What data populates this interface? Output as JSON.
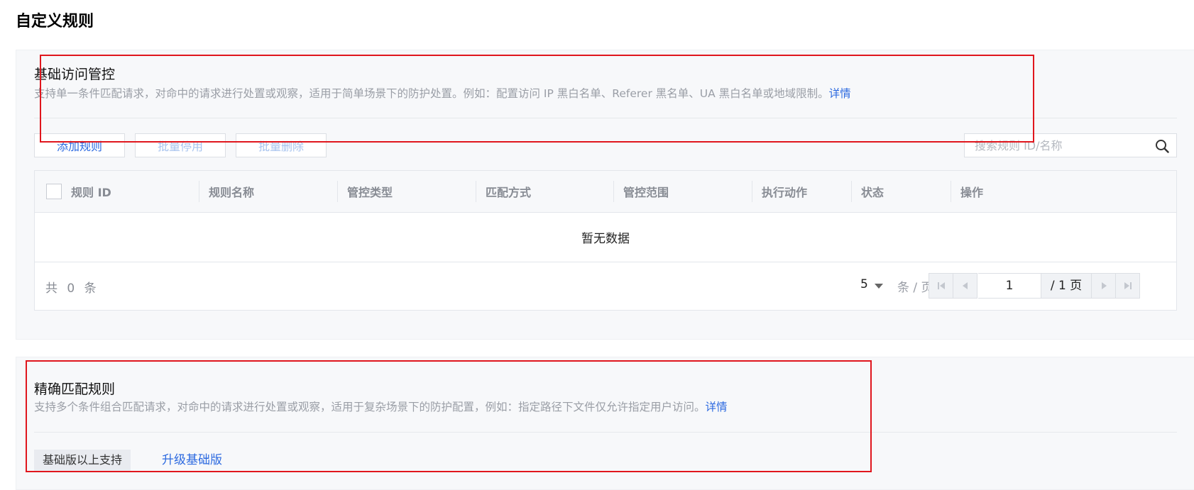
{
  "page": {
    "title": "自定义规则"
  },
  "basic_access": {
    "title": "基础访问管控",
    "description": "支持单一条件匹配请求，对命中的请求进行处置或观察，适用于简单场景下的防护处置。例如：配置访问 IP 黑白名单、Referer 黑名单、UA 黑白名单或地域限制。",
    "detail_link": "详情",
    "toolbar": {
      "add_rule": "添加规则",
      "batch_disable": "批量停用",
      "batch_delete": "批量删除",
      "search_placeholder": "搜索规则 ID/名称"
    },
    "table": {
      "columns": [
        "规则 ID",
        "规则名称",
        "管控类型",
        "匹配方式",
        "管控范围",
        "执行动作",
        "状态",
        "操作"
      ],
      "empty_text": "暂无数据"
    },
    "pagination": {
      "total_text": "共 0 条",
      "page_size": "5",
      "per_page_text": "条 / 页",
      "current_page": "1",
      "total_pages_text": "/ 1 页"
    }
  },
  "exact_match": {
    "title": "精确匹配规则",
    "description": "支持多个条件组合匹配请求，对命中的请求进行处置或观察，适用于复杂场景下的防护配置，例如：指定路径下文件仅允许指定用户访问。",
    "detail_link": "详情",
    "tier_tag": "基础版以上支持",
    "upgrade_link": "升级基础版"
  },
  "colors": {
    "link": "#2d6ae0",
    "annotation": "#e0161d",
    "section_bg": "#f7f8fa"
  }
}
